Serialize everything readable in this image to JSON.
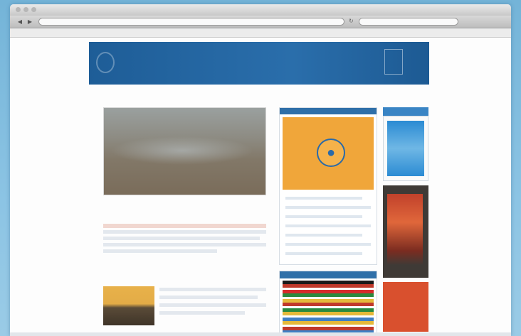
{
  "browser": {
    "window_title": "",
    "url": "",
    "bookmarks": [
      "",
      "",
      "",
      "",
      ""
    ]
  },
  "site": {
    "name": "",
    "banner_note": "",
    "nav": [
      "",
      "",
      "",
      "",
      ""
    ]
  },
  "content": {
    "lead_article_title": "",
    "section_title": ""
  },
  "sidebar": {
    "flags_label": ""
  },
  "colors": {
    "banner_blue": "#2a6eab",
    "link_blue": "#2c67b0",
    "accent_orange": "#f0a63a",
    "accent_red": "#d9502e"
  },
  "icons": {
    "org_emblem": "africa-map-icon"
  }
}
